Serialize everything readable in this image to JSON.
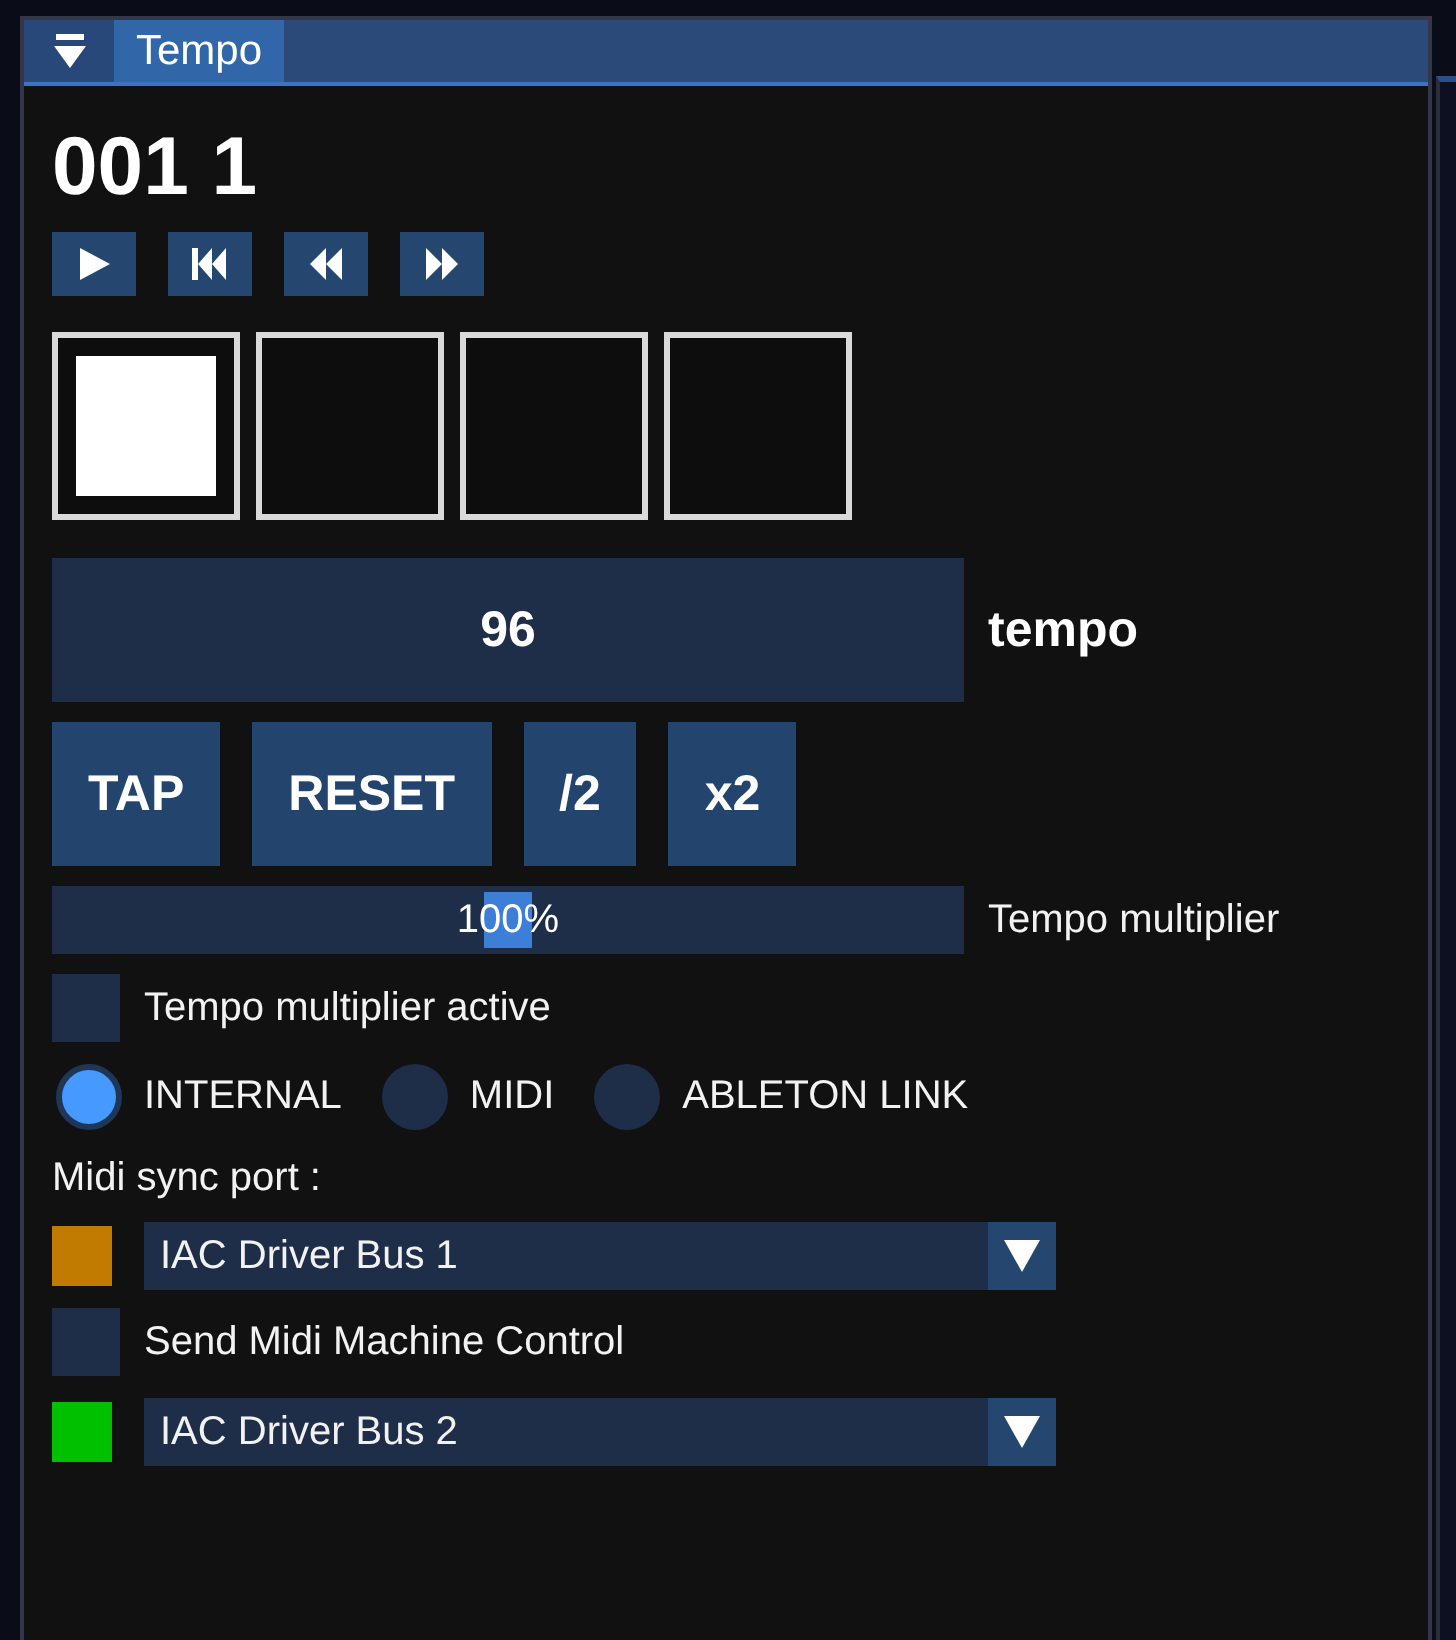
{
  "panel": {
    "tabs": [
      {
        "label": "Tempo",
        "selected": true
      }
    ]
  },
  "position": "001 1",
  "beats": [
    {
      "on": true
    },
    {
      "on": false
    },
    {
      "on": false
    },
    {
      "on": false
    }
  ],
  "tempo": {
    "value": "96",
    "label": "tempo"
  },
  "tempo_buttons": [
    "TAP",
    "RESET",
    "/2",
    "x2"
  ],
  "multiplier": {
    "value": "100%",
    "level": 0.5,
    "label": "Tempo multiplier"
  },
  "multiplier_active": {
    "label": "Tempo multiplier active",
    "checked": false
  },
  "sync_modes": [
    {
      "label": "INTERNAL",
      "selected": true
    },
    {
      "label": "MIDI",
      "selected": false
    },
    {
      "label": "ABLETON LINK",
      "selected": false
    }
  ],
  "midi_sync": {
    "label": "Midi sync port :",
    "rows": [
      {
        "kind": "port",
        "value": "IAC Driver Bus 1",
        "color": "#c17c00"
      },
      {
        "kind": "checkbox",
        "label": "Send Midi Machine Control",
        "checked": false
      },
      {
        "kind": "port",
        "value": "IAC Driver Bus 2",
        "color": "#00c000"
      }
    ]
  }
}
